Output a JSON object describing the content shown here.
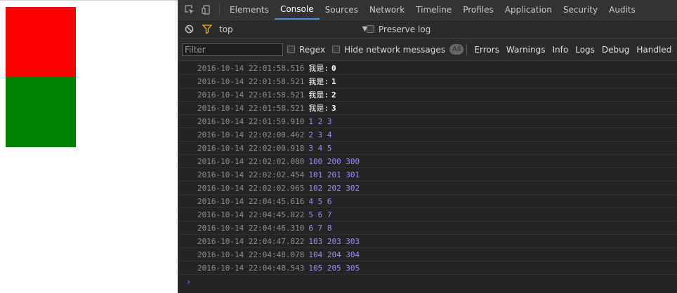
{
  "page": {
    "boxes": [
      {
        "name": "red-box",
        "color": "#ff0000"
      },
      {
        "name": "green-box",
        "color": "#008000"
      }
    ]
  },
  "devtools": {
    "tabs": [
      "Elements",
      "Console",
      "Sources",
      "Network",
      "Timeline",
      "Profiles",
      "Application",
      "Security",
      "Audits"
    ],
    "active_tab": "Console",
    "icons": {
      "inspect": "inspect-element-icon",
      "device": "device-mode-icon",
      "clear": "clear-console-icon",
      "filter": "filter-funnel-icon"
    },
    "context": {
      "value": "top",
      "preserve_log_label": "Preserve log"
    },
    "filterbar": {
      "filter_placeholder": "Filter",
      "regex_label": "Regex",
      "hide_network_label": "Hide network messages",
      "all_label": "All",
      "levels": [
        "Errors",
        "Warnings",
        "Info",
        "Logs",
        "Debug",
        "Handled"
      ]
    },
    "colors": {
      "accent": "#4a90e2",
      "number": "#9c8cff",
      "timestamp": "#8f8f8f",
      "prompt": "#4a8eff"
    },
    "prompt": "›",
    "logs": [
      {
        "ts": "2016-10-14 22:01:58.516",
        "label": "我是:",
        "value": "0"
      },
      {
        "ts": "2016-10-14 22:01:58.521",
        "label": "我是:",
        "value": "1"
      },
      {
        "ts": "2016-10-14 22:01:58.521",
        "label": "我是:",
        "value": "2"
      },
      {
        "ts": "2016-10-14 22:01:58.521",
        "label": "我是:",
        "value": "3"
      },
      {
        "ts": "2016-10-14 22:01:59.910",
        "label": "",
        "value": "1 2 3"
      },
      {
        "ts": "2016-10-14 22:02:00.462",
        "label": "",
        "value": "2 3 4"
      },
      {
        "ts": "2016-10-14 22:02:00.918",
        "label": "",
        "value": "3 4 5"
      },
      {
        "ts": "2016-10-14 22:02:02.080",
        "label": "",
        "value": "100 200 300"
      },
      {
        "ts": "2016-10-14 22:02:02.454",
        "label": "",
        "value": "101 201 301"
      },
      {
        "ts": "2016-10-14 22:02:02.965",
        "label": "",
        "value": "102 202 302"
      },
      {
        "ts": "2016-10-14 22:04:45.616",
        "label": "",
        "value": "4 5 6"
      },
      {
        "ts": "2016-10-14 22:04:45.822",
        "label": "",
        "value": "5 6 7"
      },
      {
        "ts": "2016-10-14 22:04:46.310",
        "label": "",
        "value": "6 7 8"
      },
      {
        "ts": "2016-10-14 22:04:47.822",
        "label": "",
        "value": "103 203 303"
      },
      {
        "ts": "2016-10-14 22:04:48.078",
        "label": "",
        "value": "104 204 304"
      },
      {
        "ts": "2016-10-14 22:04:48.543",
        "label": "",
        "value": "105 205 305"
      }
    ]
  }
}
